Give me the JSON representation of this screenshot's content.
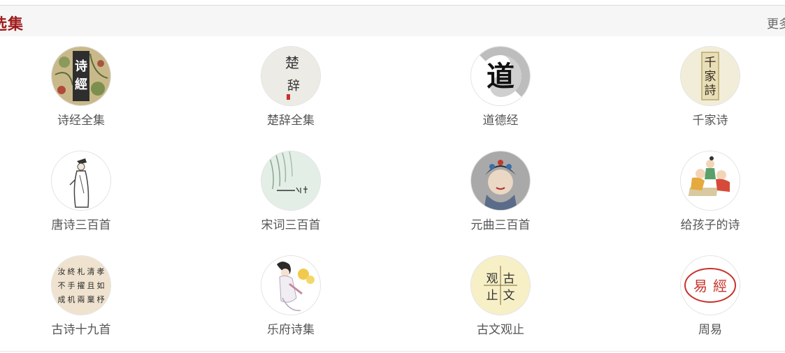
{
  "header": {
    "title": "选集",
    "more": "更多"
  },
  "items": [
    {
      "label": "诗经全集",
      "icon": "shijing-cover-icon",
      "glyphs": [
        "诗",
        "經"
      ]
    },
    {
      "label": "楚辞全集",
      "icon": "chuci-cover-icon",
      "glyphs": [
        "楚",
        "辞"
      ]
    },
    {
      "label": "道德经",
      "icon": "daodejing-cover-icon",
      "glyphs": [
        "道"
      ]
    },
    {
      "label": "千家诗",
      "icon": "qianjiashi-cover-icon",
      "glyphs": [
        "千",
        "家",
        "詩"
      ]
    },
    {
      "label": "唐诗三百首",
      "icon": "tangshi-poet-icon",
      "glyphs": []
    },
    {
      "label": "宋词三百首",
      "icon": "songci-willow-icon",
      "glyphs": []
    },
    {
      "label": "元曲三百首",
      "icon": "yuanqu-opera-icon",
      "glyphs": []
    },
    {
      "label": "给孩子的诗",
      "icon": "children-playing-icon",
      "glyphs": []
    },
    {
      "label": "古诗十九首",
      "icon": "calligraphy-icon",
      "glyphs": [
        "汝",
        "終",
        "札",
        "清",
        "孝",
        "不",
        "手",
        "擢",
        "且",
        "如",
        "成",
        "机",
        "兩",
        "棄",
        "杼"
      ]
    },
    {
      "label": "乐府诗集",
      "icon": "yuefu-lady-icon",
      "glyphs": []
    },
    {
      "label": "古文观止",
      "icon": "guwenguanzhi-cover-icon",
      "glyphs": [
        "观",
        "古",
        "止",
        "文"
      ]
    },
    {
      "label": "周易",
      "icon": "zhouyi-seal-icon",
      "glyphs": [
        "易",
        "經"
      ]
    }
  ]
}
